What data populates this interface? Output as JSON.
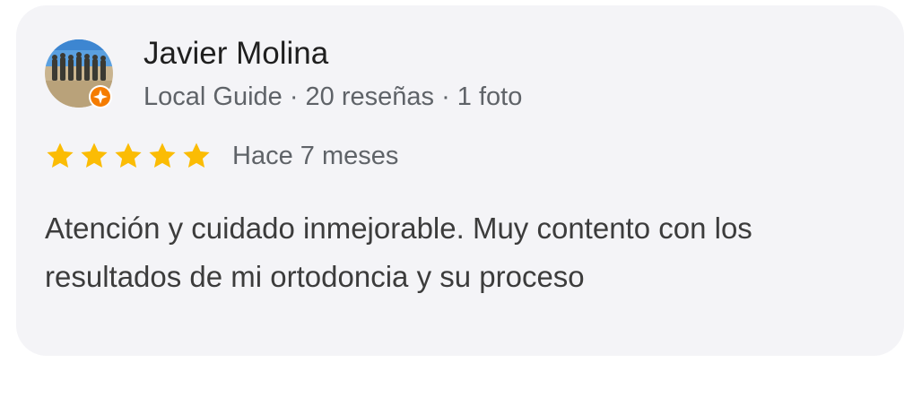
{
  "review": {
    "author_name": "Javier Molina",
    "author_meta": "Local Guide · 20 reseñas · 1 foto",
    "rating": 5,
    "rating_max": 5,
    "time": "Hace 7 meses",
    "text": "Atención y cuidado inmejorable. Muy contento con los resultados de mi ortodoncia y su proceso"
  },
  "colors": {
    "card_background": "#f4f4f7",
    "star": "#fbbc04",
    "badge": "#f57c00",
    "name_text": "#1f1f1f",
    "meta_text": "#5f6368"
  },
  "icons": {
    "avatar": "avatar-photo",
    "badge": "local-guide-badge-icon",
    "star": "star-icon"
  }
}
